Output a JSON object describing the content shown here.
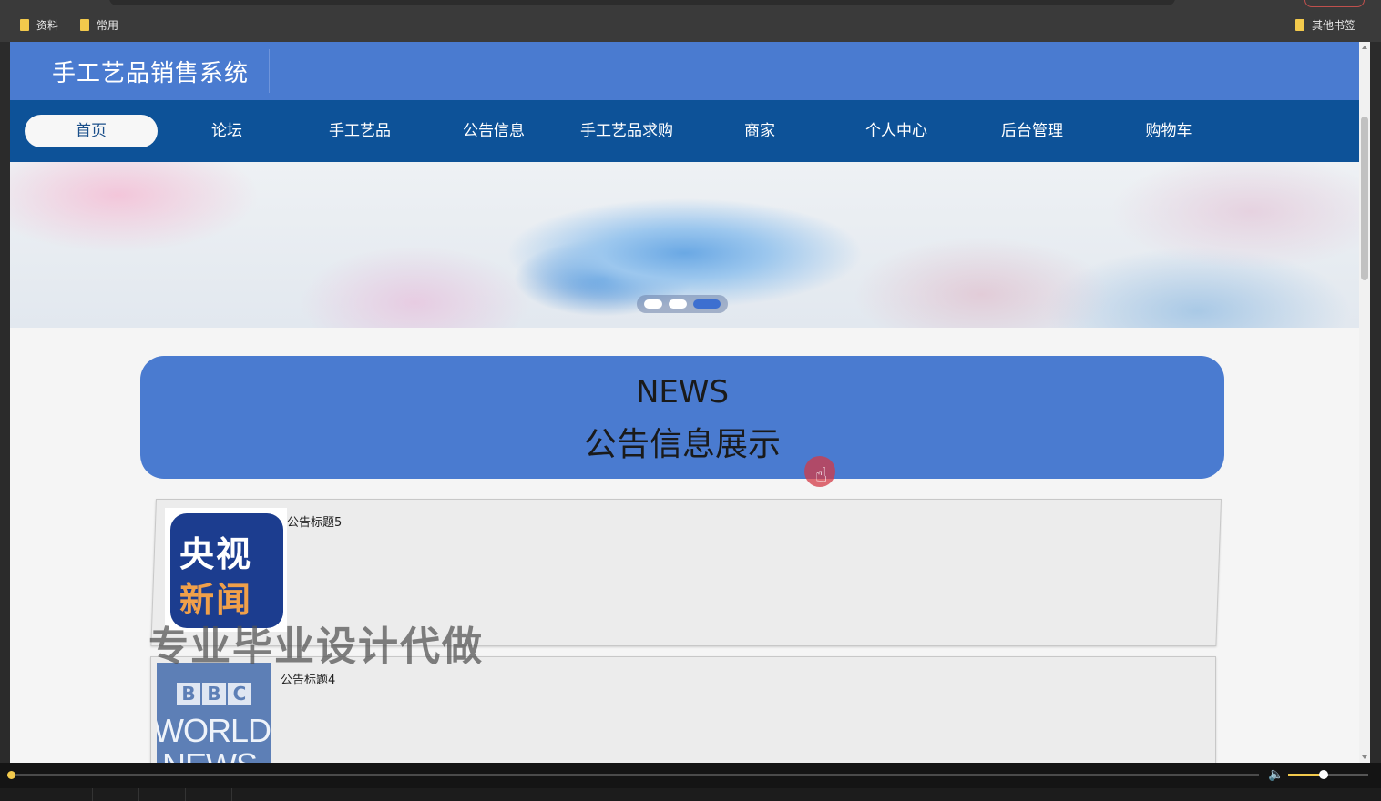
{
  "bookmarks": {
    "items": [
      "资料",
      "常用"
    ],
    "other": "其他书签"
  },
  "site": {
    "title": "手工艺品销售系统"
  },
  "nav": {
    "items": [
      "首页",
      "论坛",
      "手工艺品",
      "公告信息",
      "手工艺品求购",
      "商家",
      "个人中心",
      "后台管理",
      "购物车"
    ],
    "active_index": 0
  },
  "carousel": {
    "slide_count": 3,
    "active_slide": 3
  },
  "news_section": {
    "heading_en": "NEWS",
    "heading_cn": "公告信息展示"
  },
  "notices": [
    {
      "title": "公告标题5",
      "logo_lines": [
        "央视",
        "新闻"
      ]
    },
    {
      "title": "公告标题4",
      "logo_lines": [
        "BBC",
        "WORLD",
        "NEWS"
      ]
    }
  ],
  "watermark": "专业毕业设计代做",
  "colors": {
    "header": "#4a7bd0",
    "navbar": "#0d5298",
    "panel": "#4a7bd0",
    "accent": "#f2c94c"
  }
}
